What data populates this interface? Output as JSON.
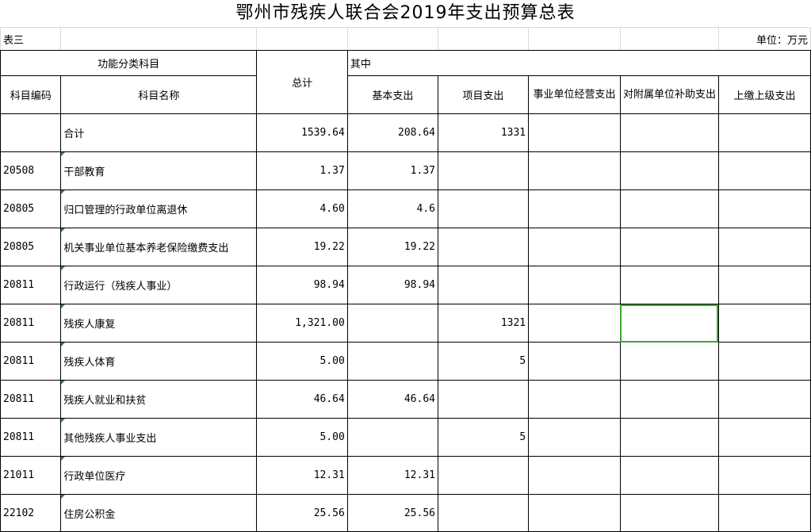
{
  "title": "鄂州市残疾人联合会2019年支出预算总表",
  "table_id": "表三",
  "unit": "单位：万元",
  "headers": {
    "func_category": "功能分类科目",
    "total": "总计",
    "of_which": "其中",
    "code": "科目编码",
    "name": "科目名称",
    "basic": "基本支出",
    "project": "项目支出",
    "business": "事业单位经营支出",
    "subsidy": "对附属单位补助支出",
    "upper": "上缴上级支出"
  },
  "total_row": {
    "code": "",
    "name": "合计",
    "total": "1539.64",
    "basic": "208.64",
    "project": "1331",
    "business": "",
    "subsidy": "",
    "upper": ""
  },
  "rows": [
    {
      "code": "20508",
      "name": "干部教育",
      "total": "1.37",
      "basic": "1.37",
      "project": "",
      "business": "",
      "subsidy": "",
      "upper": ""
    },
    {
      "code": "20805",
      "name": "归口管理的行政单位离退休",
      "total": "4.60",
      "basic": "4.6",
      "project": "",
      "business": "",
      "subsidy": "",
      "upper": ""
    },
    {
      "code": "20805",
      "name": "机关事业单位基本养老保险缴费支出",
      "total": "19.22",
      "basic": "19.22",
      "project": "",
      "business": "",
      "subsidy": "",
      "upper": ""
    },
    {
      "code": "20811",
      "name": "行政运行（残疾人事业）",
      "total": "98.94",
      "basic": "98.94",
      "project": "",
      "business": "",
      "subsidy": "",
      "upper": ""
    },
    {
      "code": "20811",
      "name": "残疾人康复",
      "total": "1,321.00",
      "basic": "",
      "project": "1321",
      "business": "",
      "subsidy": "",
      "upper": ""
    },
    {
      "code": "20811",
      "name": "残疾人体育",
      "total": "5.00",
      "basic": "",
      "project": "5",
      "business": "",
      "subsidy": "",
      "upper": ""
    },
    {
      "code": "20811",
      "name": "残疾人就业和扶贫",
      "total": "46.64",
      "basic": "46.64",
      "project": "",
      "business": "",
      "subsidy": "",
      "upper": ""
    },
    {
      "code": "20811",
      "name": "其他残疾人事业支出",
      "total": "5.00",
      "basic": "",
      "project": "5",
      "business": "",
      "subsidy": "",
      "upper": ""
    },
    {
      "code": "21011",
      "name": "行政单位医疗",
      "total": "12.31",
      "basic": "12.31",
      "project": "",
      "business": "",
      "subsidy": "",
      "upper": ""
    },
    {
      "code": "22102",
      "name": "住房公积金",
      "total": "25.56",
      "basic": "25.56",
      "project": "",
      "business": "",
      "subsidy": "",
      "upper": ""
    }
  ]
}
